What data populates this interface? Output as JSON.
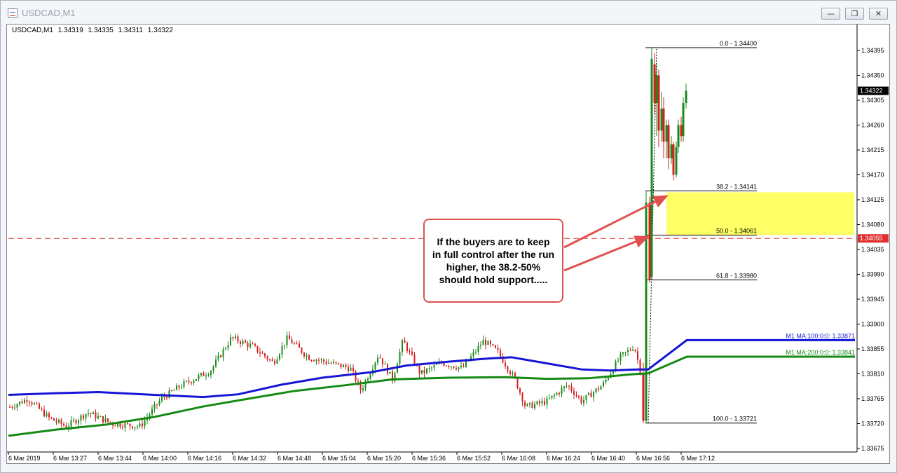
{
  "window": {
    "title": "USDCAD,M1",
    "buttons": {
      "minimize": "—",
      "restore": "❐",
      "close": "✕"
    }
  },
  "chart_header": {
    "symbol": "USDCAD,M1",
    "open": "1.34319",
    "high": "1.34335",
    "low": "1.34311",
    "close": "1.34322"
  },
  "price_axis": {
    "ticks": [
      "1.34395",
      "1.34350",
      "1.34305",
      "1.34260",
      "1.34215",
      "1.34170",
      "1.34125",
      "1.34080",
      "1.34035",
      "1.33990",
      "1.33945",
      "1.33900",
      "1.33855",
      "1.33810",
      "1.33765",
      "1.33720",
      "1.33675"
    ],
    "current_price": "1.34322",
    "hline_price": "1.34055"
  },
  "time_axis": {
    "labels": [
      "6 Mar 2019",
      "6 Mar 13:27",
      "6 Mar 13:44",
      "6 Mar 14:00",
      "6 Mar 14:16",
      "6 Mar 14:32",
      "6 Mar 14:48",
      "6 Mar 15:04",
      "6 Mar 15:20",
      "6 Mar 15:36",
      "6 Mar 15:52",
      "6 Mar 16:08",
      "6 Mar 16:24",
      "6 Mar 16:40",
      "6 Mar 16:56",
      "6 Mar 17:12"
    ]
  },
  "fibonacci": {
    "levels": [
      {
        "label": "0.0 - 1.34400",
        "price": 1.344
      },
      {
        "label": "38.2 - 1.34141",
        "price": 1.34141
      },
      {
        "label": "50.0 - 1.34061",
        "price": 1.34061
      },
      {
        "label": "61.8 - 1.33980",
        "price": 1.3398
      },
      {
        "label": "100.0 - 1.33721",
        "price": 1.33721
      }
    ],
    "zone_color": "#ffff66"
  },
  "indicators": {
    "ma100": {
      "label": "M1 MA:100:0:0: 1.33871",
      "value": 1.33871,
      "color": "#1515d6"
    },
    "ma200": {
      "label": "M1 MA:200:0:0: 1.33841",
      "value": 1.33841,
      "color": "#148a14"
    }
  },
  "colors": {
    "bull": "#1a8a1a",
    "bear": "#d42020",
    "hline": "#e03030",
    "arrow": "#e05050"
  },
  "annotation": {
    "text": "If the buyers are to keep in full control after the run higher, the 38.2-50% should hold support....."
  }
}
